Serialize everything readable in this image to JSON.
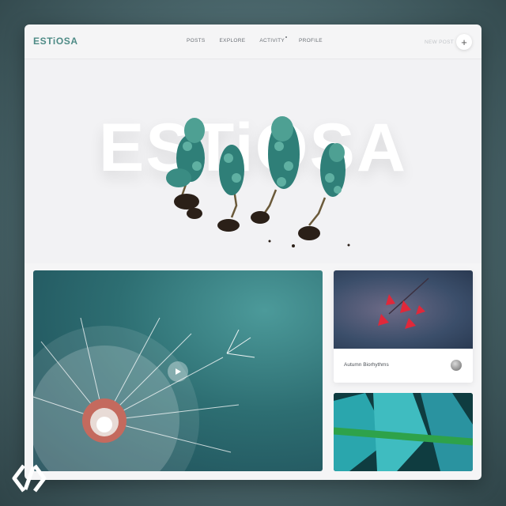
{
  "app": {
    "logo": "ESTiOSA"
  },
  "nav": {
    "items": [
      {
        "label": "POSTS"
      },
      {
        "label": "EXPLORE"
      },
      {
        "label": "ACTIVITY"
      },
      {
        "label": "PROFILE"
      }
    ],
    "new_post_label": "NEW POST",
    "plus_glyph": "+"
  },
  "hero": {
    "title": "ESTiOSA"
  },
  "cards": {
    "main": {
      "type": "video",
      "icon": "play-icon"
    },
    "side1": {
      "title": "Autumn Biorhythms"
    }
  },
  "colors": {
    "brand": "#4e8b86",
    "hero_bg": "#f2f2f4"
  }
}
